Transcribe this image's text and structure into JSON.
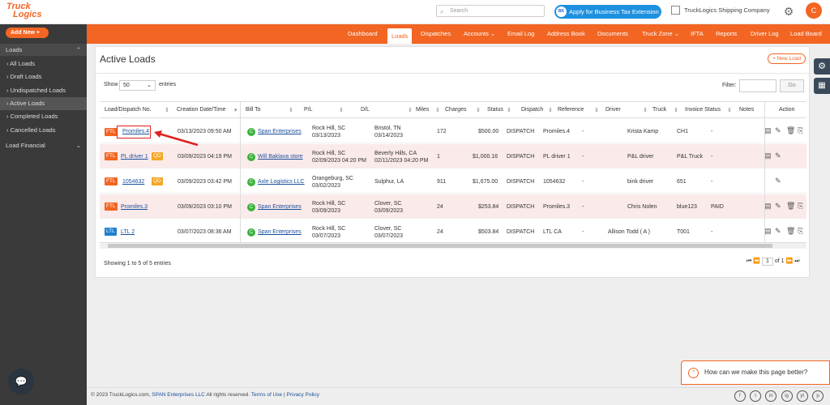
{
  "logo": {
    "line1": "Truck",
    "line2": "Logics"
  },
  "header": {
    "search_placeholder": "Search",
    "tax_button": "Apply for Business Tax Extension",
    "tax_badge": "BK",
    "company": "TruckLogics Shipping Company",
    "avatar_initial": "C"
  },
  "sidebar": {
    "add_new": "Add New",
    "section": "Loads",
    "items": [
      "All Loads",
      "Draft Loads",
      "Undispatched Loads",
      "Active Loads",
      "Completed Loads",
      "Cancelled Loads"
    ],
    "financial": "Load Financial"
  },
  "nav": [
    "Dashboard",
    "Loads",
    "Dispatches",
    "Accounts ⌄",
    "Email Log",
    "Address Book",
    "Documents",
    "Truck Zone ⌄",
    "IFTA",
    "Reports",
    "Driver Log",
    "Load Board"
  ],
  "page": {
    "title": "Active Loads",
    "new_load": "+ New Load",
    "show": "Show",
    "show_value": "50",
    "entries": "entries",
    "filter": "Filter:",
    "go": "Go",
    "showing": "Showing 1 to 5 of 5 entries",
    "page_num": "1",
    "page_of": "of 1"
  },
  "columns": [
    "Load/Dispatch No.",
    "Creation Date/Time",
    "Bill To",
    "P/L",
    "D/L",
    "Miles",
    "Charges",
    "Status",
    "Dispatch",
    "Reference",
    "Driver",
    "Truck",
    "Invoice Status",
    "Notes",
    "Action"
  ],
  "rows": [
    {
      "type": "FTL",
      "qd": "",
      "no": "Promiles.4",
      "created": "03/13/2023 09:50 AM",
      "bill": "Span Enterprises",
      "pl1": "Rock Hill, SC",
      "pl2": "03/13/2023",
      "dl1": "Bristol, TN",
      "dl2": "03/14/2023",
      "miles": "172",
      "charges": "$500.00",
      "status": "DISPATCH",
      "dispatch": "Promiles.4",
      "ref": "-",
      "driver": "Krista Kamp",
      "truck": "CH1",
      "invoice": "-"
    },
    {
      "type": "FTL",
      "qd": "QD",
      "no": "PL driver 1",
      "created": "03/09/2023 04:19 PM",
      "bill": "Will Baklava store",
      "pl1": "Rock Hill, SC",
      "pl2": "02/09/2023 04:20 PM",
      "dl1": "Beverly Hills, CA",
      "dl2": "02/11/2023 04:20 PM",
      "miles": "1",
      "charges": "$1,000.16",
      "status": "DISPATCH",
      "dispatch": "PL driver 1",
      "ref": "-",
      "driver": "P&L driver",
      "truck": "P&L Truck",
      "invoice": "-"
    },
    {
      "type": "FTL",
      "qd": "QD",
      "no": "1054632",
      "created": "03/09/2023 03:42 PM",
      "bill": "Axle Logistics LLC",
      "pl1": "Orangeburg, SC",
      "pl2": "03/02/2023",
      "dl1": "Sulphur, LA",
      "dl2": "",
      "miles": "911",
      "charges": "$1,675.00",
      "status": "DISPATCH",
      "dispatch": "1054632",
      "ref": "-",
      "driver": "bink driver",
      "truck": "651",
      "invoice": "-"
    },
    {
      "type": "FTL",
      "qd": "",
      "no": "Promiles.3",
      "created": "03/09/2023 03:10 PM",
      "bill": "Span Enterprises",
      "pl1": "Rock Hill, SC",
      "pl2": "03/09/2023",
      "dl1": "Clover, SC",
      "dl2": "03/09/2023",
      "miles": "24",
      "charges": "$253.84",
      "status": "DISPATCH",
      "dispatch": "Promiles.3",
      "ref": "-",
      "driver": "Chris Nolen",
      "truck": "blue123",
      "invoice": "PAID"
    },
    {
      "type": "LTL",
      "qd": "",
      "no": "LTL 2",
      "created": "03/07/2023 08:36 AM",
      "bill": "Span Enterprises",
      "pl1": "Rock Hill, SC",
      "pl2": "03/07/2023",
      "dl1": "Clover, SC",
      "dl2": "03/07/2023",
      "miles": "24",
      "charges": "$503.84",
      "status": "DISPATCH",
      "dispatch": "LTL CA",
      "ref": "-",
      "driver": "Allison Todd ( A )",
      "truck": "T001",
      "invoice": "-"
    }
  ],
  "feedback": "How can we make this page better?",
  "footer": {
    "copyright": "© 2023 TruckLogics.com,",
    "company": "SPAN Enterprises LLC",
    "rights": "All rights reserved.",
    "terms": "Terms of Use",
    "sep": "|",
    "privacy": "Privacy Policy"
  },
  "socials": [
    "f",
    "t",
    "in",
    "ig",
    "yt",
    "p"
  ]
}
